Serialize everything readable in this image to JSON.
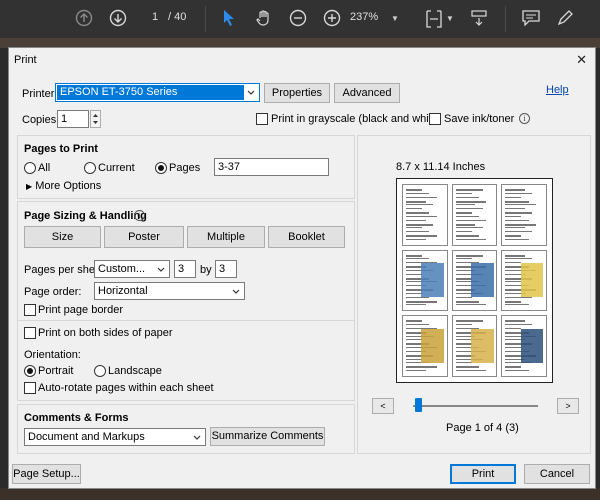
{
  "toolbar": {
    "page_current": "1",
    "page_total": "/ 40",
    "zoom": "237%",
    "icons": [
      "up-arrow-icon",
      "down-arrow-icon",
      "select-cursor-icon",
      "hand-icon",
      "zoom-out-icon",
      "zoom-in-icon",
      "fit-page-icon",
      "scroll-mode-icon",
      "comment-icon",
      "pen-icon"
    ]
  },
  "dialog": {
    "title": "Print",
    "close": "✕",
    "printer_label": "Printer:",
    "printer_value": "EPSON ET-3750 Series",
    "properties_label": "Properties",
    "advanced_label": "Advanced",
    "help_label": "Help",
    "copies_label": "Copies:",
    "copies_value": "1",
    "grayscale_label": "Print in grayscale (black and white)",
    "save_ink_label": "Save ink/toner",
    "pages_to_print": {
      "title": "Pages to Print",
      "all_label": "All",
      "current_label": "Current",
      "pages_label": "Pages",
      "pages_value": "3-37",
      "selected": "Pages",
      "more_options": "More Options"
    },
    "page_sizing": {
      "title": "Page Sizing & Handling",
      "tabs": [
        "Size",
        "Poster",
        "Multiple",
        "Booklet"
      ],
      "pages_per_sheet_label": "Pages per sheet:",
      "pages_per_sheet_value": "Custom...",
      "cols": "3",
      "by_label": "by",
      "rows": "3",
      "page_order_label": "Page order:",
      "page_order_value": "Horizontal",
      "print_border_label": "Print page border",
      "both_sides_label": "Print on both sides of paper",
      "orientation_label": "Orientation:",
      "portrait_label": "Portrait",
      "landscape_label": "Landscape",
      "orientation_selected": "Portrait",
      "auto_rotate_label": "Auto-rotate pages within each sheet"
    },
    "comments_forms": {
      "title": "Comments & Forms",
      "value": "Document and Markups",
      "summarize_label": "Summarize Comments"
    },
    "preview": {
      "size_label": "8.7 x 11.14 Inches",
      "page_of": "Page 1 of 4 (3)",
      "prev": "<",
      "next": ">",
      "slider_position": 0
    },
    "page_setup_label": "Page Setup...",
    "print_label": "Print",
    "cancel_label": "Cancel"
  }
}
